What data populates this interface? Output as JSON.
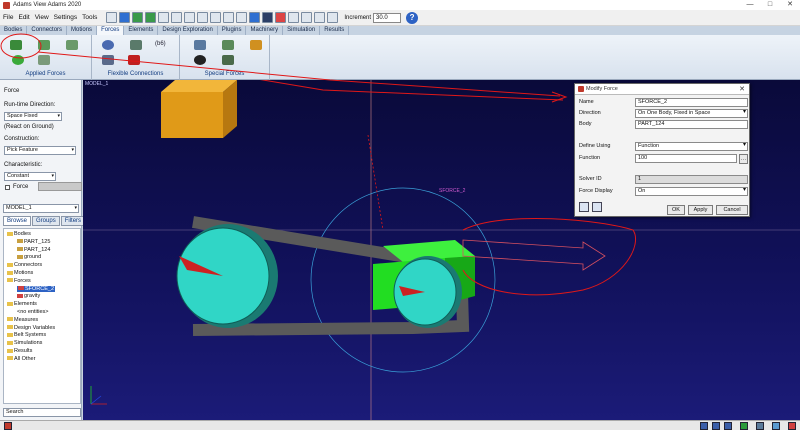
{
  "window": {
    "title": "Adams View Adams 2020",
    "controls": [
      "—",
      "□",
      "✕"
    ]
  },
  "menubar": {
    "items": [
      "File",
      "Edit",
      "View",
      "Settings",
      "Tools"
    ]
  },
  "toolbar": {
    "increment_label": "Increment",
    "increment_value": "30.0",
    "help_icon": "?"
  },
  "ribbon_tabs": [
    "Bodies",
    "Connectors",
    "Motions",
    "Forces",
    "Elements",
    "Design Exploration",
    "Plugins",
    "Machinery",
    "Simulation",
    "Results"
  ],
  "active_tab": "Forces",
  "ribbon_groups": {
    "applied": "Applied Forces",
    "flexible": "Flexible Connections",
    "special": "Special Forces"
  },
  "ribbon_icon_text": "(b6)",
  "left_panel": {
    "heading": "Force",
    "run_time_direction_label": "Run-time Direction:",
    "run_time_direction_value": "Space Fixed",
    "react_on_ground": "(React on Ground)",
    "construction_label": "Construction:",
    "construction_value": "Pick Feature",
    "characteristic_label": "Characteristic:",
    "characteristic_value": "Constant",
    "force_label": "Force",
    "model_select": "MODEL_1",
    "browser_tabs": [
      "Browse",
      "Groups",
      "Filters"
    ],
    "tree": [
      {
        "label": "Bodies",
        "indent": 0,
        "kind": "folder",
        "expanded": true
      },
      {
        "label": "PART_125",
        "indent": 1,
        "kind": "part"
      },
      {
        "label": "PART_124",
        "indent": 1,
        "kind": "part"
      },
      {
        "label": "ground",
        "indent": 1,
        "kind": "part"
      },
      {
        "label": "Connectors",
        "indent": 0,
        "kind": "folder"
      },
      {
        "label": "Motions",
        "indent": 0,
        "kind": "folder"
      },
      {
        "label": "Forces",
        "indent": 0,
        "kind": "folder",
        "expanded": true
      },
      {
        "label": "SFORCE_2",
        "indent": 1,
        "kind": "force",
        "selected": true
      },
      {
        "label": "gravity",
        "indent": 1,
        "kind": "force"
      },
      {
        "label": "Elements",
        "indent": 0,
        "kind": "folder",
        "expanded": true
      },
      {
        "label": "<no entities>",
        "indent": 1,
        "kind": "none"
      },
      {
        "label": "Measures",
        "indent": 0,
        "kind": "folder"
      },
      {
        "label": "Design Variables",
        "indent": 0,
        "kind": "folder"
      },
      {
        "label": "Belt Systems",
        "indent": 0,
        "kind": "folder"
      },
      {
        "label": "Simulations",
        "indent": 0,
        "kind": "folder"
      },
      {
        "label": "Results",
        "indent": 0,
        "kind": "folder"
      },
      {
        "label": "All Other",
        "indent": 0,
        "kind": "folder"
      }
    ],
    "search_value": "Search"
  },
  "viewport": {
    "model_label": "MODEL_1",
    "force_label": "SFORCE_2",
    "background": "#11115a"
  },
  "dialog": {
    "title": "Modify Force",
    "name_label": "Name",
    "name_value": "SFORCE_2",
    "direction_label": "Direction",
    "direction_value": "On One Body, Fixed in Space",
    "body_label": "Body",
    "body_value": "PART_124",
    "define_using_label": "Define Using",
    "define_using_value": "Function",
    "function_label": "Function",
    "function_value": "100",
    "solver_id_label": "Solver ID",
    "solver_id_value": "1",
    "force_display_label": "Force Display",
    "force_display_value": "On",
    "ok": "OK",
    "apply": "Apply",
    "cancel": "Cancel"
  },
  "colors": {
    "annotation_red": "#e01818",
    "part_orange": "#e0a020",
    "part_green": "#22dd22",
    "pulley_teal": "#2fd1c2",
    "belt_gray": "#555555"
  }
}
